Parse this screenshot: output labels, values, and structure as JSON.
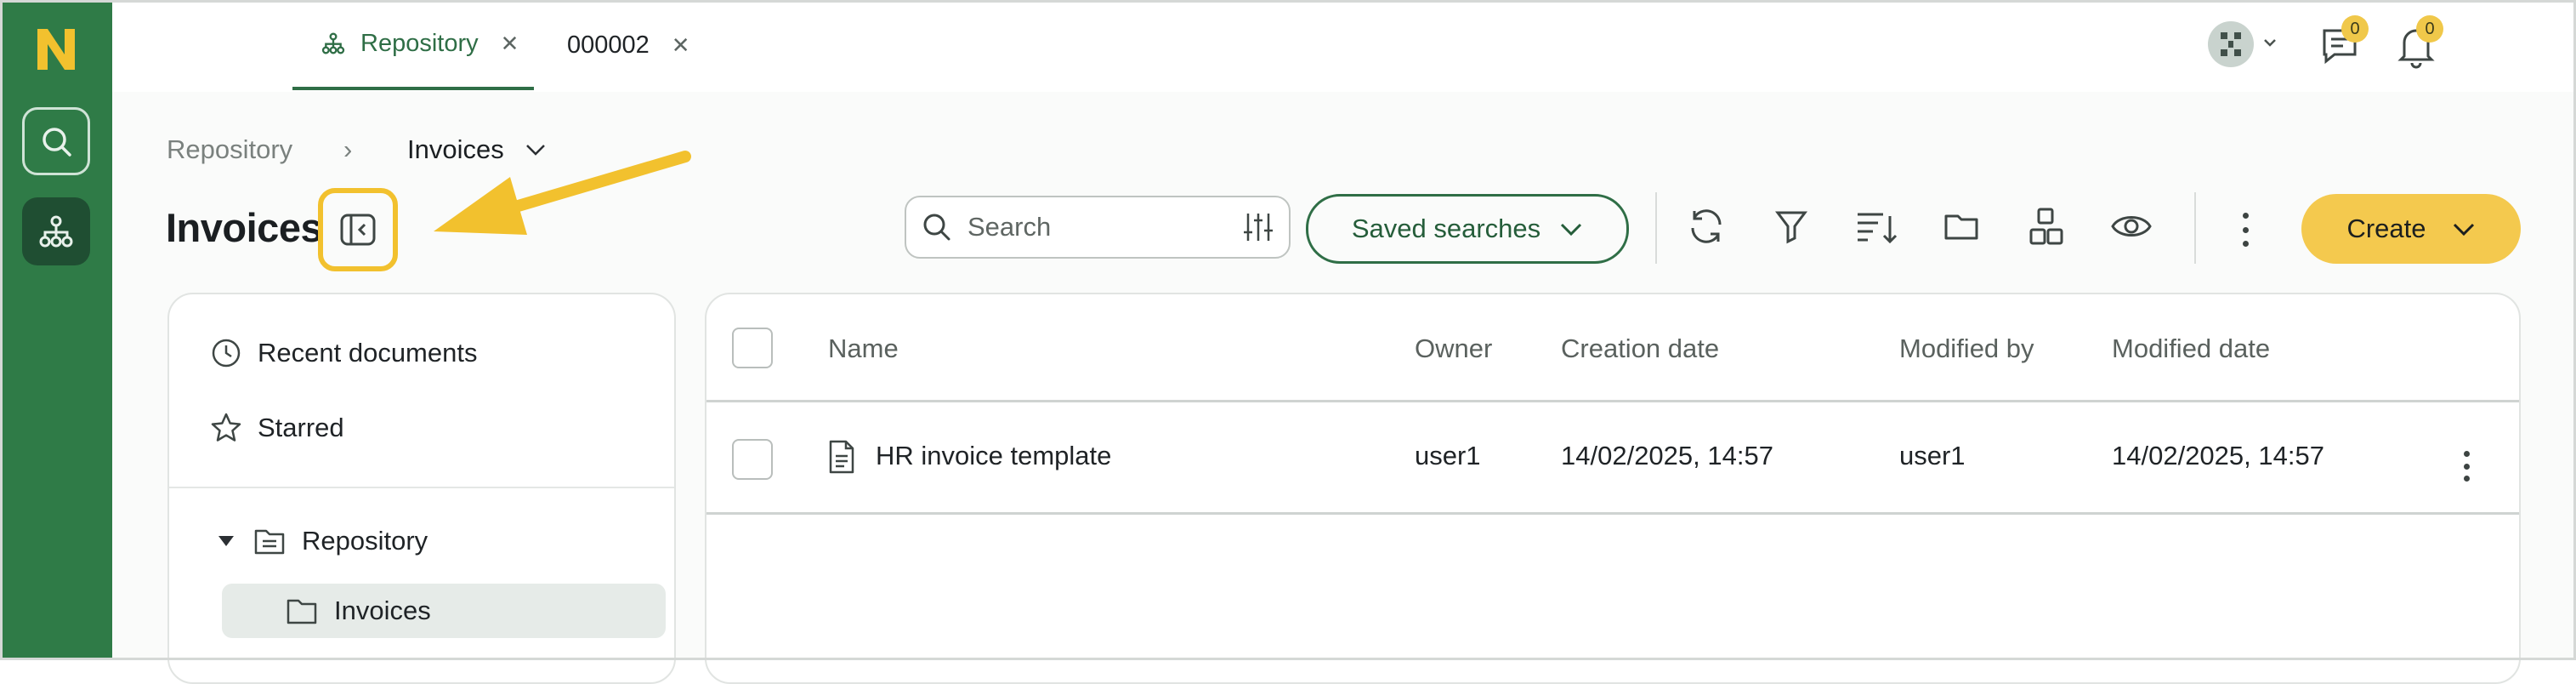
{
  "app": {
    "logo_letter": "N",
    "accent": "#2f7b47",
    "highlight": "#f2c12e"
  },
  "rail": {
    "items": [
      {
        "icon": "search-icon"
      },
      {
        "icon": "repository-tree-icon"
      }
    ]
  },
  "tabs": [
    {
      "label": "Repository",
      "icon": "repository-tree-icon",
      "active": true
    },
    {
      "label": "000002",
      "active": false
    }
  ],
  "header": {
    "chat_badge": "0",
    "notifications_badge": "0"
  },
  "breadcrumb": {
    "root": "Repository",
    "separator": "›",
    "current": "Invoices"
  },
  "page": {
    "title": "Invoices"
  },
  "toolbar": {
    "search_placeholder": "Search",
    "saved_searches_label": "Saved searches",
    "create_label": "Create"
  },
  "sidebar": {
    "items": [
      {
        "label": "Recent documents",
        "icon": "clock-icon"
      },
      {
        "label": "Starred",
        "icon": "star-icon"
      }
    ],
    "tree": [
      {
        "label": "Repository",
        "icon": "repository-folder-icon",
        "expanded": true
      },
      {
        "label": "Invoices",
        "icon": "folder-icon",
        "selected": true
      }
    ]
  },
  "table": {
    "columns": [
      "Name",
      "Owner",
      "Creation date",
      "Modified by",
      "Modified date"
    ],
    "rows": [
      {
        "name": "HR invoice template",
        "owner": "user1",
        "created": "14/02/2025, 14:57",
        "modified_by": "user1",
        "modified": "14/02/2025, 14:57"
      }
    ]
  }
}
